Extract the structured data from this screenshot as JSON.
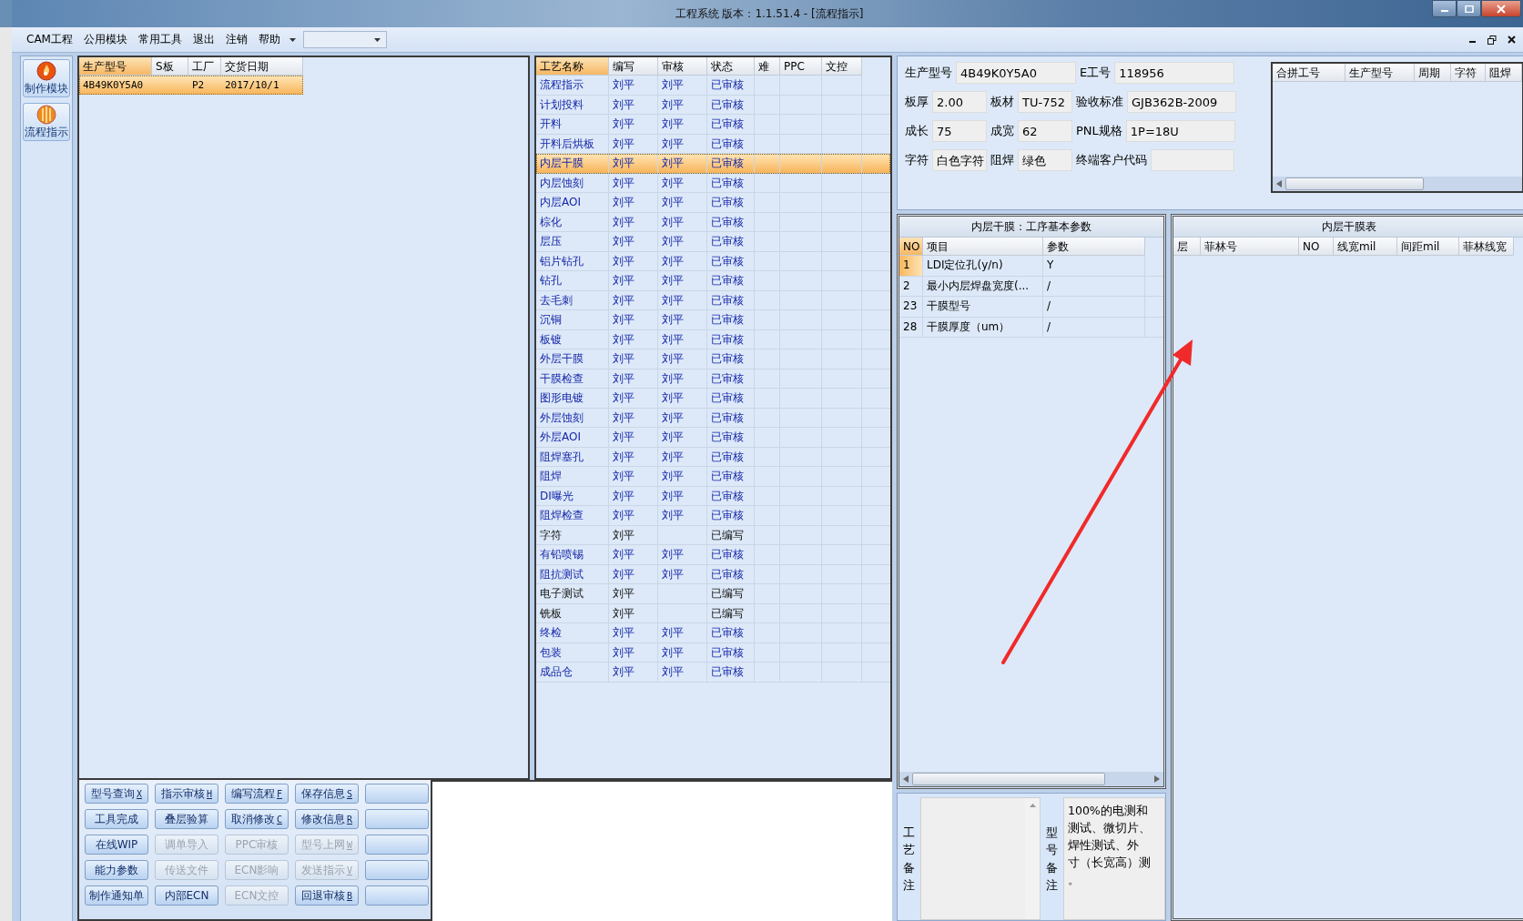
{
  "window": {
    "title": "工程系统  版本：1.1.51.4 - [流程指示]"
  },
  "menu": {
    "items": [
      "CAM工程",
      "公用模块",
      "常用工具",
      "退出",
      "注销",
      "帮助"
    ]
  },
  "nav": [
    {
      "label": "制作模块",
      "kind": "flame"
    },
    {
      "label": "流程指示",
      "kind": "ball"
    }
  ],
  "orders": {
    "columns": [
      {
        "label": "生产型号",
        "active": true
      },
      {
        "label": "S板",
        "active": false
      },
      {
        "label": "工厂",
        "active": false
      },
      {
        "label": "交货日期",
        "active": false
      }
    ],
    "rows": [
      {
        "model": "4B49K0Y5A0",
        "factory": "P2",
        "date": "2017/10/1",
        "selected": true
      }
    ]
  },
  "process": {
    "columns": [
      {
        "label": "工艺名称",
        "active": true
      },
      {
        "label": "编写",
        "active": false
      },
      {
        "label": "审核",
        "active": false
      },
      {
        "label": "状态",
        "active": false
      },
      {
        "label": "难",
        "active": false
      },
      {
        "label": "PPC",
        "active": false
      },
      {
        "label": "文控",
        "active": false
      }
    ],
    "rows": [
      {
        "name": "流程指示",
        "writer": "刘平",
        "reviewer": "刘平",
        "status": "已审核",
        "approved": true,
        "selected": false
      },
      {
        "name": "计划投料",
        "writer": "刘平",
        "reviewer": "刘平",
        "status": "已审核",
        "approved": true,
        "selected": false
      },
      {
        "name": "开料",
        "writer": "刘平",
        "reviewer": "刘平",
        "status": "已审核",
        "approved": true,
        "selected": false
      },
      {
        "name": "开料后烘板",
        "writer": "刘平",
        "reviewer": "刘平",
        "status": "已审核",
        "approved": true,
        "selected": false
      },
      {
        "name": "内层干膜",
        "writer": "刘平",
        "reviewer": "刘平",
        "status": "已审核",
        "approved": true,
        "selected": true
      },
      {
        "name": "内层蚀刻",
        "writer": "刘平",
        "reviewer": "刘平",
        "status": "已审核",
        "approved": true,
        "selected": false
      },
      {
        "name": "内层AOI",
        "writer": "刘平",
        "reviewer": "刘平",
        "status": "已审核",
        "approved": true,
        "selected": false
      },
      {
        "name": "棕化",
        "writer": "刘平",
        "reviewer": "刘平",
        "status": "已审核",
        "approved": true,
        "selected": false
      },
      {
        "name": "层压",
        "writer": "刘平",
        "reviewer": "刘平",
        "status": "已审核",
        "approved": true,
        "selected": false
      },
      {
        "name": "铝片钻孔",
        "writer": "刘平",
        "reviewer": "刘平",
        "status": "已审核",
        "approved": true,
        "selected": false
      },
      {
        "name": "钻孔",
        "writer": "刘平",
        "reviewer": "刘平",
        "status": "已审核",
        "approved": true,
        "selected": false
      },
      {
        "name": "去毛刺",
        "writer": "刘平",
        "reviewer": "刘平",
        "status": "已审核",
        "approved": true,
        "selected": false
      },
      {
        "name": "沉铜",
        "writer": "刘平",
        "reviewer": "刘平",
        "status": "已审核",
        "approved": true,
        "selected": false
      },
      {
        "name": "板镀",
        "writer": "刘平",
        "reviewer": "刘平",
        "status": "已审核",
        "approved": true,
        "selected": false
      },
      {
        "name": "外层干膜",
        "writer": "刘平",
        "reviewer": "刘平",
        "status": "已审核",
        "approved": true,
        "selected": false
      },
      {
        "name": "干膜检查",
        "writer": "刘平",
        "reviewer": "刘平",
        "status": "已审核",
        "approved": true,
        "selected": false
      },
      {
        "name": "图形电镀",
        "writer": "刘平",
        "reviewer": "刘平",
        "status": "已审核",
        "approved": true,
        "selected": false
      },
      {
        "name": "外层蚀刻",
        "writer": "刘平",
        "reviewer": "刘平",
        "status": "已审核",
        "approved": true,
        "selected": false
      },
      {
        "name": "外层AOI",
        "writer": "刘平",
        "reviewer": "刘平",
        "status": "已审核",
        "approved": true,
        "selected": false
      },
      {
        "name": "阻焊塞孔",
        "writer": "刘平",
        "reviewer": "刘平",
        "status": "已审核",
        "approved": true,
        "selected": false
      },
      {
        "name": "阻焊",
        "writer": "刘平",
        "reviewer": "刘平",
        "status": "已审核",
        "approved": true,
        "selected": false
      },
      {
        "name": "DI曝光",
        "writer": "刘平",
        "reviewer": "刘平",
        "status": "已审核",
        "approved": true,
        "selected": false
      },
      {
        "name": "阻焊检查",
        "writer": "刘平",
        "reviewer": "刘平",
        "status": "已审核",
        "approved": true,
        "selected": false
      },
      {
        "name": "字符",
        "writer": "刘平",
        "status": "已编写",
        "approved": false,
        "selected": false
      },
      {
        "name": "有铅喷锡",
        "writer": "刘平",
        "reviewer": "刘平",
        "status": "已审核",
        "approved": true,
        "selected": false
      },
      {
        "name": "阻抗测试",
        "writer": "刘平",
        "reviewer": "刘平",
        "status": "已审核",
        "approved": true,
        "selected": false
      },
      {
        "name": "电子测试",
        "writer": "刘平",
        "status": "已编写",
        "approved": false,
        "selected": false
      },
      {
        "name": "铣板",
        "writer": "刘平",
        "status": "已编写",
        "approved": false,
        "selected": false
      },
      {
        "name": "终检",
        "writer": "刘平",
        "reviewer": "刘平",
        "status": "已审核",
        "approved": true,
        "selected": false
      },
      {
        "name": "包装",
        "writer": "刘平",
        "reviewer": "刘平",
        "status": "已审核",
        "approved": true,
        "selected": false
      },
      {
        "name": "成品仓",
        "writer": "刘平",
        "reviewer": "刘平",
        "status": "已审核",
        "approved": true,
        "selected": false
      }
    ]
  },
  "buttons": [
    {
      "kind": "label",
      "label": "型号查询",
      "shortcut": "X",
      "disabled": false
    },
    {
      "kind": "label",
      "label": "指示审核",
      "shortcut": "H",
      "disabled": false
    },
    {
      "kind": "label",
      "label": "编写流程",
      "shortcut": "F",
      "disabled": false
    },
    {
      "kind": "label",
      "label": "保存信息",
      "shortcut": "S",
      "disabled": false
    },
    {
      "kind": "blank"
    },
    {
      "kind": "label",
      "label": "工具完成",
      "disabled": false
    },
    {
      "kind": "label",
      "label": "叠层验算",
      "disabled": false
    },
    {
      "kind": "label",
      "label": "取消修改",
      "shortcut": "C",
      "disabled": false
    },
    {
      "kind": "label",
      "label": "修改信息",
      "shortcut": "R",
      "disabled": false
    },
    {
      "kind": "blank"
    },
    {
      "kind": "label",
      "label": "在线WIP",
      "disabled": false
    },
    {
      "kind": "label",
      "label": "调单导入",
      "disabled": true
    },
    {
      "kind": "label",
      "label": "PPC审核",
      "disabled": true
    },
    {
      "kind": "label",
      "label": "型号上网",
      "shortcut": "W",
      "disabled": true
    },
    {
      "kind": "blank"
    },
    {
      "kind": "label",
      "label": "能力参数",
      "disabled": false
    },
    {
      "kind": "label",
      "label": "传送文件",
      "disabled": true
    },
    {
      "kind": "label",
      "label": "ECN影响",
      "disabled": true
    },
    {
      "kind": "label",
      "label": "发送指示",
      "shortcut": "V",
      "disabled": true
    },
    {
      "kind": "blank"
    },
    {
      "kind": "label",
      "label": "制作通知单",
      "disabled": false
    },
    {
      "kind": "label",
      "label": "内部ECN",
      "disabled": false
    },
    {
      "kind": "label",
      "label": "ECN文控",
      "disabled": true
    },
    {
      "kind": "label",
      "label": "回退审核",
      "shortcut": "B",
      "disabled": false
    },
    {
      "kind": "blank"
    }
  ],
  "info": {
    "fields": [
      {
        "label": "生产型号",
        "value": "4B49K0Y5A0"
      },
      {
        "label": "E工号",
        "value": "118956"
      },
      {
        "label": "板厚",
        "value": "2.00"
      },
      {
        "label": "板材",
        "value": "TU-752"
      },
      {
        "label": "验收标准",
        "value": "GJB362B-2009"
      },
      {
        "label": "成长",
        "value": "75"
      },
      {
        "label": "成宽",
        "value": "62"
      },
      {
        "label": "PNL规格",
        "value": "1P=18U"
      },
      {
        "label": "字符",
        "value": "白色字符"
      },
      {
        "label": "阻焊",
        "value": "绿色"
      },
      {
        "label": "终端客户代码"
      }
    ]
  },
  "combine": {
    "columns": [
      "合拼工号",
      "生产型号",
      "周期",
      "字符",
      "阻焊"
    ]
  },
  "params": {
    "title": "内层干膜：工序基本参数",
    "columns": [
      {
        "label": "NO",
        "active": true
      },
      {
        "label": "项目",
        "active": false
      },
      {
        "label": "参数",
        "active": false
      }
    ],
    "rows": [
      {
        "no": "1",
        "item": "LDI定位孔(y/n)",
        "value": "Y",
        "selected": true
      },
      {
        "no": "2",
        "item": "最小内层焊盘宽度(...",
        "value": "/",
        "selected": false
      },
      {
        "no": "23",
        "item": "干膜型号",
        "value": "/",
        "selected": false
      },
      {
        "no": "28",
        "item": "干膜厚度（um）",
        "value": "/",
        "selected": false
      }
    ]
  },
  "film": {
    "title": "内层干膜表",
    "columns": [
      "层",
      "菲林号",
      "NO",
      "线宽mil",
      "间距mil",
      "菲林线宽"
    ]
  },
  "remarks": {
    "process_label": "工艺备注",
    "model_label": "型号备注",
    "model_lines": [
      "100%的电测和",
      "测试、微切片、",
      "焊性测试、外",
      "寸（长宽高）测",
      "。"
    ]
  }
}
